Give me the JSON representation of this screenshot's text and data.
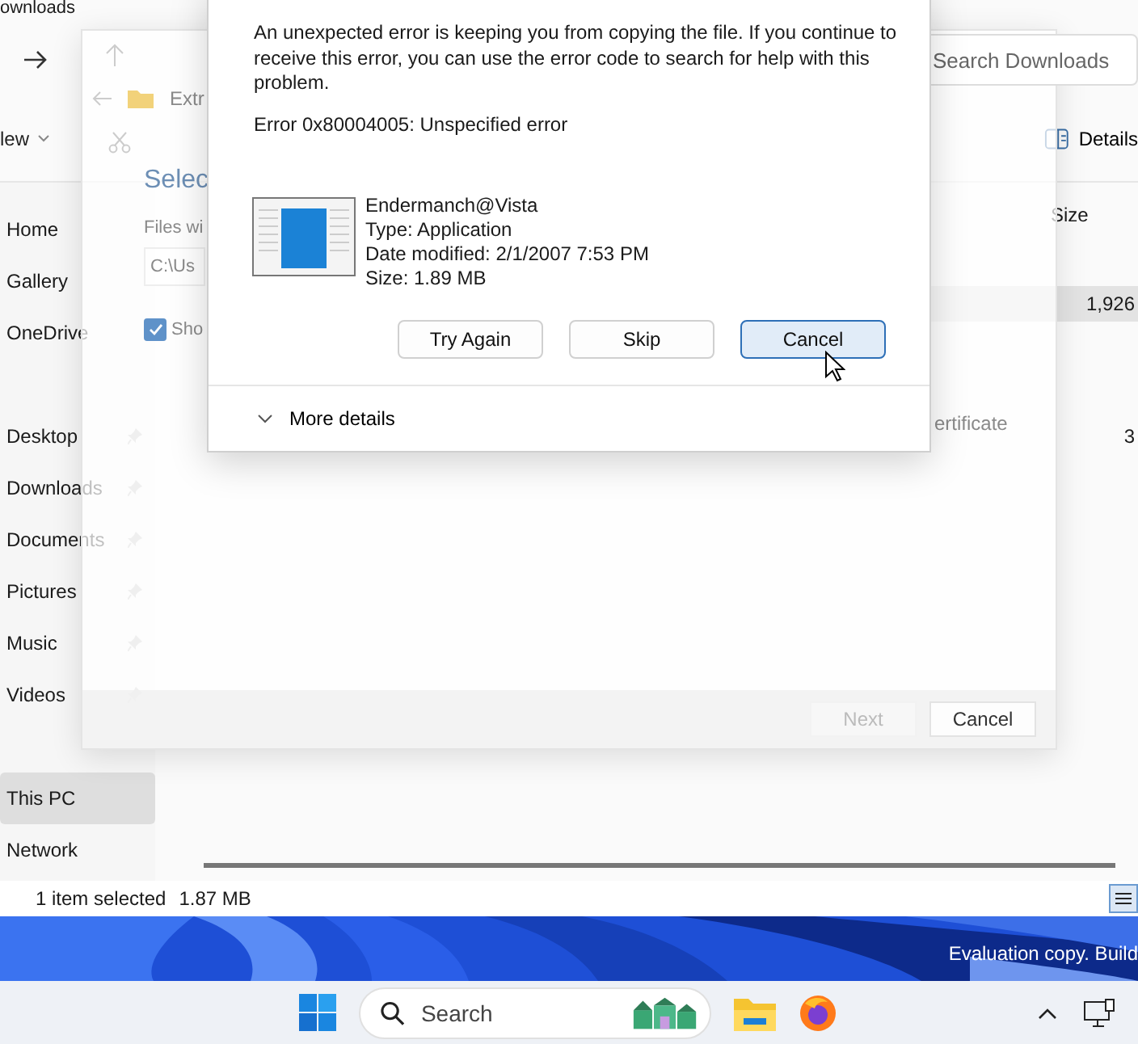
{
  "explorer": {
    "title": "ownloads",
    "search": {
      "placeholder": "Search Downloads"
    },
    "new_button": "lew",
    "details_button": "Details",
    "column_header": "Size",
    "rows": [
      {
        "size": "1,926",
        "selected": true
      },
      {
        "size": "3",
        "selected": false
      }
    ],
    "sidebar": {
      "groups": [
        {
          "items": [
            {
              "label": "Home",
              "pinned": false,
              "selected": false
            },
            {
              "label": "Gallery",
              "pinned": false,
              "selected": false
            },
            {
              "label": "OneDrive",
              "pinned": false,
              "selected": false
            }
          ]
        },
        {
          "items": [
            {
              "label": "Desktop",
              "pinned": true,
              "selected": false
            },
            {
              "label": "Downloads",
              "pinned": true,
              "selected": false
            },
            {
              "label": "Documents",
              "pinned": true,
              "selected": false
            },
            {
              "label": "Pictures",
              "pinned": true,
              "selected": false
            },
            {
              "label": "Music",
              "pinned": true,
              "selected": false
            },
            {
              "label": "Videos",
              "pinned": true,
              "selected": false
            }
          ]
        },
        {
          "items": [
            {
              "label": "This PC",
              "pinned": false,
              "selected": true
            },
            {
              "label": "Network",
              "pinned": false,
              "selected": false
            }
          ]
        }
      ]
    },
    "status_bar": {
      "selection": "1 item selected",
      "size": "1.87 MB"
    }
  },
  "wizard": {
    "breadcrumb": "Extr",
    "heading": "Selec",
    "label": "Files wi",
    "path": "C:\\Us",
    "checkbox": {
      "label": "Sho",
      "checked": true
    },
    "row_text": "ertificate",
    "buttons": [
      {
        "label": "Next",
        "disabled": true
      },
      {
        "label": "Cancel",
        "disabled": false
      }
    ]
  },
  "dialog": {
    "message": "An unexpected error is keeping you from copying the file. If you continue to receive this error, you can use the error code to search for help with this problem.",
    "error": "Error 0x80004005: Unspecified error",
    "file": {
      "name": "Endermanch@Vista",
      "type": "Type: Application",
      "modified": "Date modified: 2/1/2007 7:53 PM",
      "size": "Size: 1.89 MB"
    },
    "buttons": [
      {
        "label": "Try Again",
        "selected": false
      },
      {
        "label": "Skip",
        "selected": false
      },
      {
        "label": "Cancel",
        "selected": true
      }
    ],
    "more_details": "More details"
  },
  "desktop": {
    "watermark": "Evaluation copy. Build"
  },
  "taskbar": {
    "search": {
      "placeholder": "Search"
    }
  }
}
